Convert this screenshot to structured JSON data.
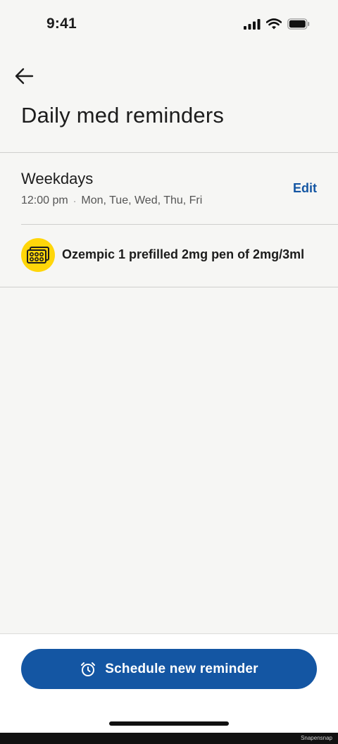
{
  "status_bar": {
    "time": "9:41"
  },
  "header": {
    "title": "Daily med reminders"
  },
  "schedule": {
    "name": "Weekdays",
    "time": "12:00 pm",
    "days": "Mon, Tue, Wed, Thu, Fri",
    "edit_label": "Edit"
  },
  "medication": {
    "name": "Ozempic 1 prefilled 2mg pen of 2mg/3ml",
    "icon": "pill-pack-icon",
    "icon_bg": "#ffd60a"
  },
  "footer": {
    "button_label": "Schedule new reminder",
    "button_icon": "alarm-clock-icon"
  },
  "watermark": "Snapensnap",
  "colors": {
    "accent": "#1456a3",
    "background": "#f6f6f4"
  }
}
